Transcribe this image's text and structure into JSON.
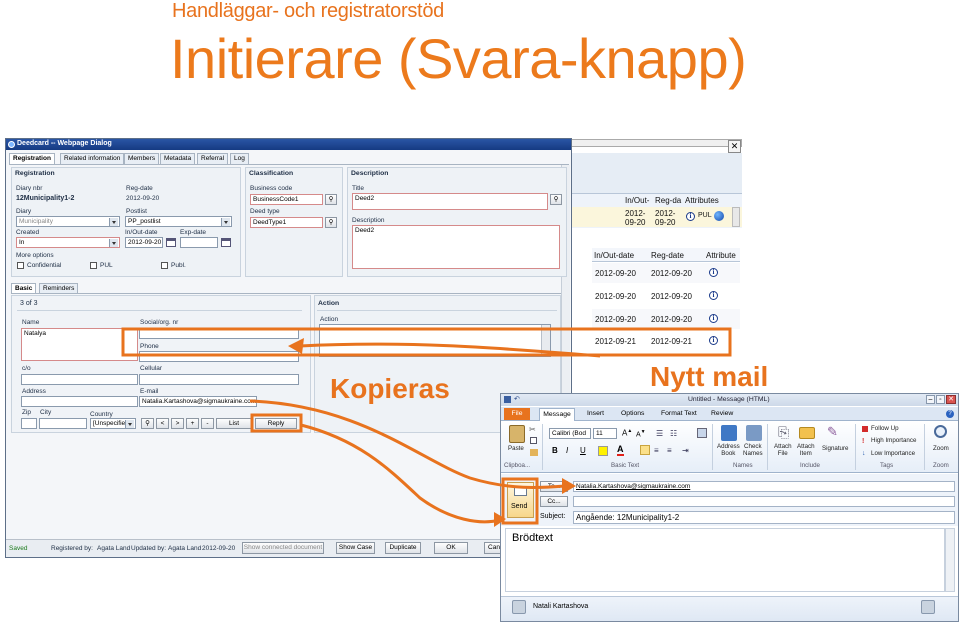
{
  "slide": {
    "subtitle": "Handläggar- och registratorstöd",
    "title": "Initierare (Svara-knapp)",
    "callout_copy": "Kopieras",
    "callout_new_mail": "Nytt mail",
    "colors": {
      "orange": "#E8731E",
      "title_orange": "#EC7A1C"
    }
  },
  "grid": {
    "header_top": [
      "In/Out-",
      "Reg-da",
      "Attributes"
    ],
    "top_row": {
      "inout": "2012-\n09-20",
      "reg": "2012-\n09-20",
      "attr": "PUL"
    },
    "header": [
      "In/Out-date",
      "Reg-date",
      "Attribute"
    ],
    "rows": [
      {
        "inout": "2012-09-20",
        "reg": "2012-09-20"
      },
      {
        "inout": "2012-09-20",
        "reg": "2012-09-20"
      },
      {
        "inout": "2012-09-20",
        "reg": "2012-09-20"
      },
      {
        "inout": "2012-09-20",
        "reg": "2012-09-20"
      },
      {
        "inout": "2012-09-21",
        "reg": "2012-09-21"
      }
    ]
  },
  "deedcard": {
    "window_title": "Deedcard -- Webpage Dialog",
    "tabs": [
      "Registration",
      "Related information",
      "Members",
      "Metadata",
      "Referral",
      "Log"
    ],
    "registration": {
      "title": "Registration",
      "diary_nbr_label": "Diary nbr",
      "diary_nbr_value": "12Municipality1-2",
      "reg_date_label": "Reg-date",
      "reg_date_value": "2012-09-20",
      "diary_label": "Diary",
      "diary_value": "Municipality",
      "postlist_label": "Postlist",
      "postlist_value": "PP_postlist",
      "created_label": "Created",
      "created_value": "In",
      "inout_date_label": "In/Out-date",
      "inout_date_value": "2012-09-20",
      "exp_date_label": "Exp-date",
      "more_options": "More options",
      "chk_confidential": "Confidential",
      "chk_pul": "PUL",
      "chk_publ": "Publ."
    },
    "classification": {
      "title": "Classification",
      "business_code_label": "Business code",
      "business_code_value": "BusinessCode1",
      "deed_type_label": "Deed type",
      "deed_type_value": "DeedType1"
    },
    "description": {
      "title": "Description",
      "title_label": "Title",
      "title_value": "Deed2",
      "description_label": "Description",
      "description_value": "Deed2"
    },
    "subtabs": [
      "Basic",
      "Reminders"
    ],
    "basic": {
      "counter": "3 of 3",
      "name_label": "Name",
      "name_value": "Natalya",
      "social_label": "Social/org. nr",
      "phone_label": "Phone",
      "co_label": "c/o",
      "cellular_label": "Cellular",
      "address_label": "Address",
      "email_label": "E-mail",
      "email_value": "Natalia.Kartashova@sigmaukraine.com",
      "zip_label": "Zip",
      "city_label": "City",
      "country_label": "Country",
      "country_value": "[Unspecified]",
      "nav_search": "🔍",
      "nav_prev": "<",
      "nav_next": ">",
      "nav_add": "+",
      "nav_remove": "-",
      "list_button": "List",
      "reply_button": "Reply"
    },
    "action": {
      "title": "Action",
      "action_label": "Action"
    },
    "status": {
      "saved": "Saved",
      "registered_by_label": "Registered by:",
      "registered_by": "Agata Land",
      "updated_by_label": "Updated by:",
      "updated_by": "Agata Land",
      "date": "2012-09-20",
      "show_connected": "Show connected document",
      "show_case": "Show Case",
      "duplicate": "Duplicate",
      "ok": "OK",
      "cancel": "Can"
    }
  },
  "outlook": {
    "window_title": "Untitled - Message (HTML)",
    "tabs": [
      "File",
      "Message",
      "Insert",
      "Options",
      "Format Text",
      "Review"
    ],
    "clipboard": {
      "paste": "Paste",
      "group": "Clipboa..."
    },
    "font": {
      "name": "Calibri (Bod",
      "size": "11",
      "group": "Basic Text",
      "bold": "B",
      "italic": "I",
      "underline": "U"
    },
    "names": {
      "address_book": "Address\nBook",
      "check_names": "Check\nNames",
      "group": "Names"
    },
    "include": {
      "attach_file": "Attach\nFile",
      "attach_item": "Attach\nItem",
      "signature": "Signature",
      "group": "Include"
    },
    "tags": {
      "follow_up": "Follow Up",
      "high_importance": "High Importance",
      "low_importance": "Low Importance",
      "group": "Tags"
    },
    "zoom": {
      "label": "Zoom",
      "group": "Zoom"
    },
    "send_label": "Send",
    "to_label": "To...",
    "to_value": "Natalia.Kartashova@sigmaukraine.com",
    "cc_label": "Cc...",
    "subject_label": "Subject:",
    "subject_value": "Angående: 12Municipality1-2",
    "body_text": "Brödtext",
    "people_name": "Natali Kartashova"
  }
}
